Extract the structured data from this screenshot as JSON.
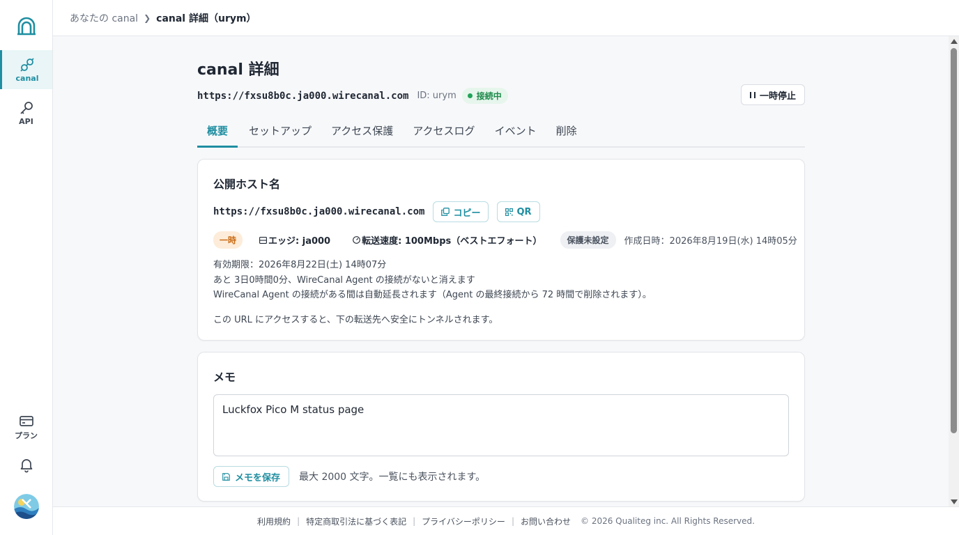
{
  "sidebar": {
    "logo": "arch-logo-icon",
    "items": [
      {
        "label": "canal",
        "icon": "link-icon",
        "active": true
      },
      {
        "label": "API",
        "icon": "key-icon",
        "active": false
      },
      {
        "label": "プラン",
        "icon": "card-icon",
        "active": false
      }
    ],
    "bell_icon": "bell-icon"
  },
  "header": {
    "breadcrumb": [
      "あなたの canal",
      "canal 詳細（urym）"
    ]
  },
  "page": {
    "title": "canal 詳細",
    "url": "https://fxsu8b0c.ja000.wirecanal.com",
    "id_text": "ID: urym",
    "status": "接続中",
    "pause_label": "一時停止"
  },
  "tabs": [
    {
      "label": "概要",
      "active": true
    },
    {
      "label": "セットアップ",
      "active": false
    },
    {
      "label": "アクセス保護",
      "active": false
    },
    {
      "label": "アクセスログ",
      "active": false
    },
    {
      "label": "イベント",
      "active": false
    },
    {
      "label": "削除",
      "active": false
    }
  ],
  "host_card": {
    "title": "公開ホスト名",
    "url": "https://fxsu8b0c.ja000.wirecanal.com",
    "copy_label": "コピー",
    "qr_label": "QR",
    "tag_temp": "一時",
    "edge": "エッジ: ja000",
    "speed": "転送速度: 100Mbps（ベストエフォート）",
    "protection": "保護未設定",
    "created": "作成日時：2026年8月19日(水) 14時05分",
    "expiry": "有効期限：2026年8月22日(土) 14時07分",
    "remaining": "あと 3日0時間0分、WireCanal Agent の接続がないと消えます",
    "auto_extend": "WireCanal Agent の接続がある間は自動延長されます（Agent の最終接続から 72 時間で削除されます）。",
    "tunnel_note": "この URL にアクセスすると、下の転送先へ安全にトンネルされます。"
  },
  "memo_card": {
    "title": "メモ",
    "value": "Luckfox Pico M status page",
    "save_label": "メモを保存",
    "hint": "最大 2000 文字。一覧にも表示されます。"
  },
  "footer": {
    "links": [
      "利用規約",
      "特定商取引法に基づく表記",
      "プライバシーポリシー",
      "お問い合わせ"
    ],
    "copyright": "© 2026 Qualiteg inc. All Rights Reserved."
  },
  "colors": {
    "accent": "#1f8ea1",
    "status_green": "#22a35a",
    "tag_orange": "#c96a12"
  }
}
